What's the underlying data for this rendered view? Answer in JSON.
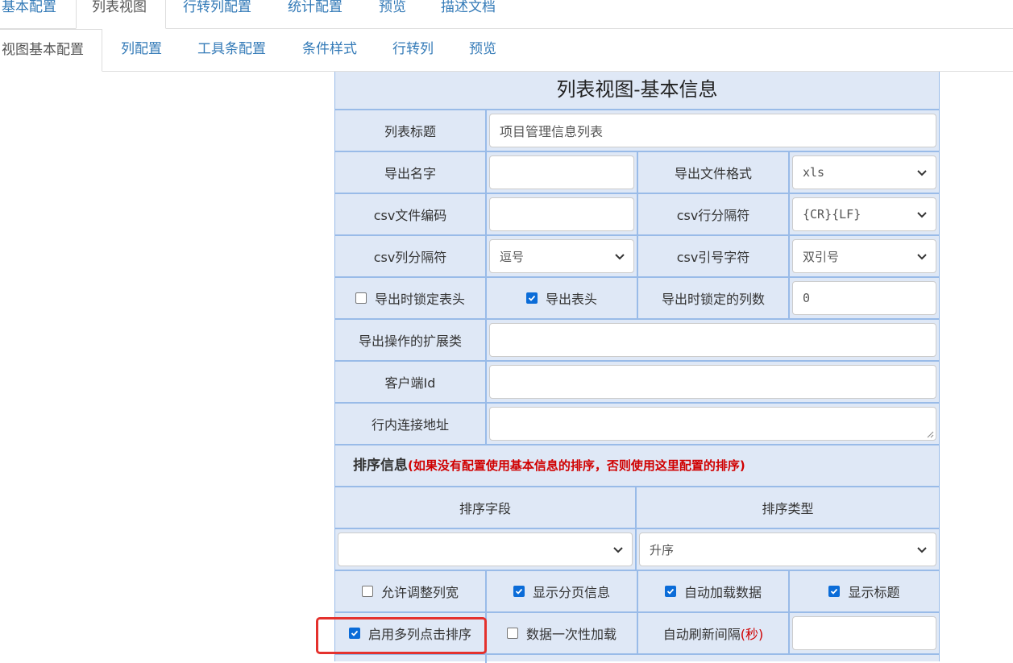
{
  "top_tabs": [
    {
      "label": "基本配置",
      "active": false
    },
    {
      "label": "列表视图",
      "active": true
    },
    {
      "label": "行转列配置",
      "active": false
    },
    {
      "label": "统计配置",
      "active": false
    },
    {
      "label": "预览",
      "active": false
    },
    {
      "label": "描述文档",
      "active": false
    }
  ],
  "sub_tabs": [
    {
      "label": "视图基本配置",
      "active": true
    },
    {
      "label": "列配置",
      "active": false
    },
    {
      "label": "工具条配置",
      "active": false
    },
    {
      "label": "条件样式",
      "active": false
    },
    {
      "label": "行转列",
      "active": false
    },
    {
      "label": "预览",
      "active": false
    }
  ],
  "panel": {
    "title": "列表视图-基本信息",
    "list_title": {
      "label": "列表标题",
      "value": "项目管理信息列表"
    },
    "export_name": {
      "label": "导出名字",
      "value": ""
    },
    "export_format": {
      "label": "导出文件格式",
      "value": "xls"
    },
    "csv_encoding": {
      "label": "csv文件编码",
      "value": ""
    },
    "csv_row_sep": {
      "label": "csv行分隔符",
      "value": "{CR}{LF}"
    },
    "csv_col_sep": {
      "label": "csv列分隔符",
      "value": "逗号"
    },
    "csv_quote": {
      "label": "csv引号字符",
      "value": "双引号"
    },
    "lock_header": {
      "label": "导出时锁定表头",
      "checked": false
    },
    "export_header": {
      "label": "导出表头",
      "checked": true
    },
    "locked_cols": {
      "label": "导出时锁定的列数",
      "value": "0"
    },
    "export_ext": {
      "label": "导出操作的扩展类",
      "value": ""
    },
    "client_id": {
      "label": "客户端Id",
      "value": ""
    },
    "inline_url": {
      "label": "行内连接地址",
      "value": ""
    },
    "sort_section": {
      "label": "排序信息",
      "note": "(如果没有配置使用基本信息的排序，否则使用这里配置的排序)"
    },
    "sort_field": {
      "label": "排序字段",
      "value": ""
    },
    "sort_type": {
      "label": "排序类型",
      "value": "升序"
    },
    "allow_resize": {
      "label": "允许调整列宽",
      "checked": false
    },
    "show_paging": {
      "label": "显示分页信息",
      "checked": true
    },
    "auto_load": {
      "label": "自动加载数据",
      "checked": true
    },
    "show_title": {
      "label": "显示标题",
      "checked": true
    },
    "multi_sort": {
      "label": "启用多列点击排序",
      "checked": true
    },
    "load_once": {
      "label": "数据一次性加载",
      "checked": false
    },
    "refresh_interval": {
      "label": "自动刷新间隔",
      "unit": "(秒)",
      "value": ""
    }
  },
  "colors": {
    "accent": "#337ab7",
    "panel_bg": "#dfe8f6",
    "border": "#99bbe8",
    "highlight": "#e4312d",
    "note": "#d00000"
  }
}
